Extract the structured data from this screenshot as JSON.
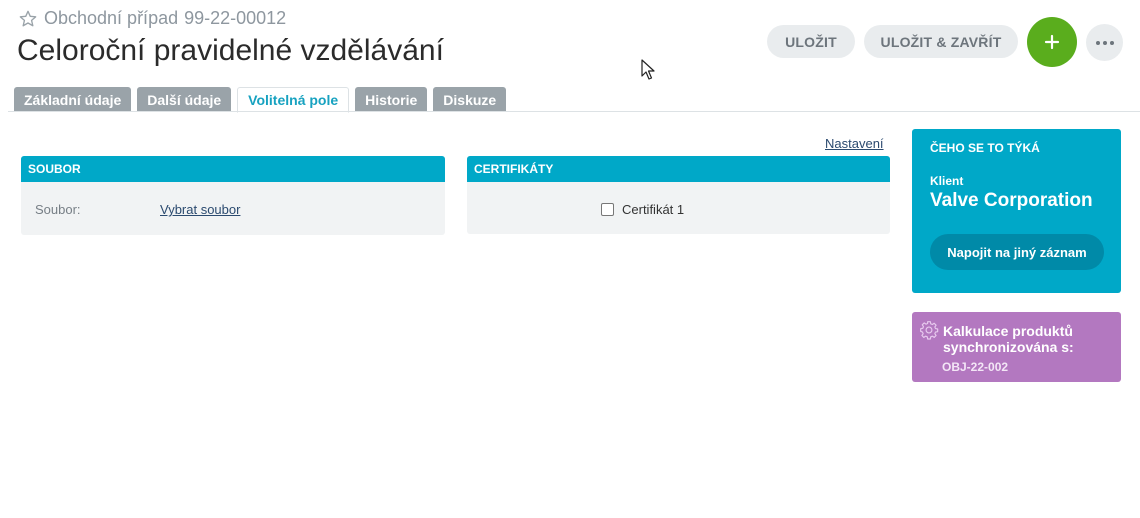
{
  "header": {
    "breadcrumb_type": "Obchodní případ",
    "breadcrumb_id": "99-22-00012",
    "title": "Celoroční pravidelné vzdělávání"
  },
  "toolbar": {
    "save_label": "ULOŽIT",
    "save_close_label": "ULOŽIT & ZAVŘÍT",
    "add_icon": "plus-icon",
    "more_icon": "more-dots-icon",
    "add_color": "#5aad1d"
  },
  "tabs": [
    {
      "label": "Základní údaje",
      "active": false
    },
    {
      "label": "Další údaje",
      "active": false
    },
    {
      "label": "Volitelná pole",
      "active": true
    },
    {
      "label": "Historie",
      "active": false
    },
    {
      "label": "Diskuze",
      "active": false
    }
  ],
  "main": {
    "settings_link": "Nastavení",
    "soubor_panel": {
      "title": "SOUBOR",
      "field_label": "Soubor:",
      "field_action": "Vybrat soubor"
    },
    "cert_panel": {
      "title": "CERTIFIKÁTY",
      "checkbox_label": "Certifikát 1",
      "checked": false
    }
  },
  "sidebar": {
    "card_title": "ČEHO SE TO TÝKÁ",
    "client_label": "Klient",
    "client_value": "Valve Corporation",
    "relink_button": "Napojit na jiný záznam",
    "sync_text": "Kalkulace produktů synchronizována s:",
    "sync_code": "OBJ-22-002",
    "accent_color": "#00a8c8",
    "sync_color": "#b378c0"
  }
}
